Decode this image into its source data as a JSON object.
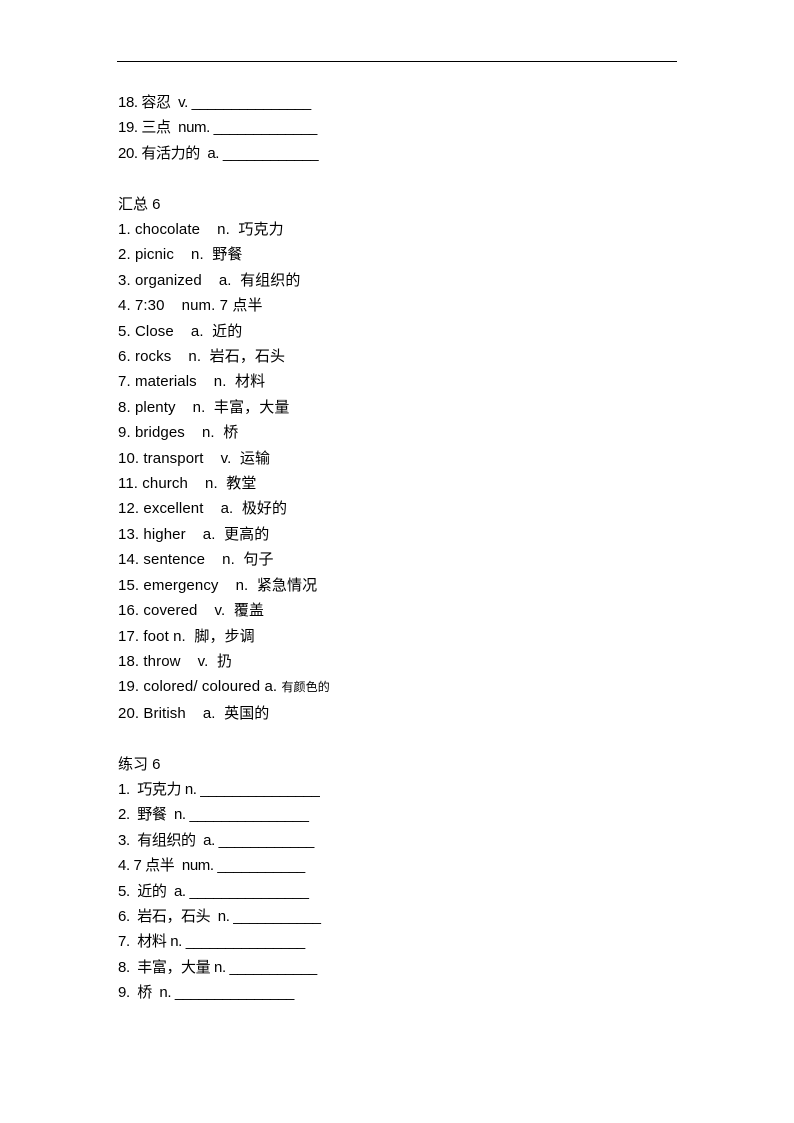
{
  "document": {
    "has_header_rule": true,
    "text_color": "#000000",
    "background_color": "#ffffff"
  },
  "continued_exercise": {
    "items": [
      "18. 容忍  v. _______________",
      "19. 三点  num. _____________",
      "20. 有活力的  a. ____________"
    ]
  },
  "vocabulary_section": {
    "title": "汇总 6",
    "items": [
      {
        "text": "1. chocolate    n.  巧克力"
      },
      {
        "text": "2. picnic    n.  野餐"
      },
      {
        "text": "3. organized    a.  有组织的"
      },
      {
        "text": "4. 7:30    num. 7 点半"
      },
      {
        "text": "5. Close    a.  近的"
      },
      {
        "text": "6. rocks    n.  岩石，石头"
      },
      {
        "text": "7. materials    n.  材料"
      },
      {
        "text": "8. plenty    n.  丰富，大量"
      },
      {
        "text": "9. bridges    n.  桥"
      },
      {
        "text": "10. transport    v.  运输"
      },
      {
        "text": "11. church    n.  教堂"
      },
      {
        "text": "12. excellent    a.  极好的"
      },
      {
        "text": "13. higher    a.  更高的"
      },
      {
        "text": "14. sentence    n.  句子"
      },
      {
        "text": "15. emergency    n.  紧急情况"
      },
      {
        "text": "16. covered    v.  覆盖"
      },
      {
        "text": "17. foot n.  脚，步调"
      },
      {
        "text": "18. throw    v.  扔"
      },
      {
        "prefix": "19. colored/ coloured a. ",
        "gloss": "有颜色的",
        "gloss_small": true
      },
      {
        "text": "20. British    a.  英国的"
      }
    ]
  },
  "practice_section": {
    "title": "练习 6",
    "items": [
      "1.  巧克力 n. _______________",
      "2.  野餐  n. _______________",
      "3.  有组织的  a. ____________",
      "4. 7 点半  num. ___________",
      "5.  近的  a. _______________",
      "6.  岩石，石头  n. ___________",
      "7.  材料 n. _______________",
      "8.  丰富，大量 n. ___________",
      "9.  桥  n. _______________"
    ]
  }
}
